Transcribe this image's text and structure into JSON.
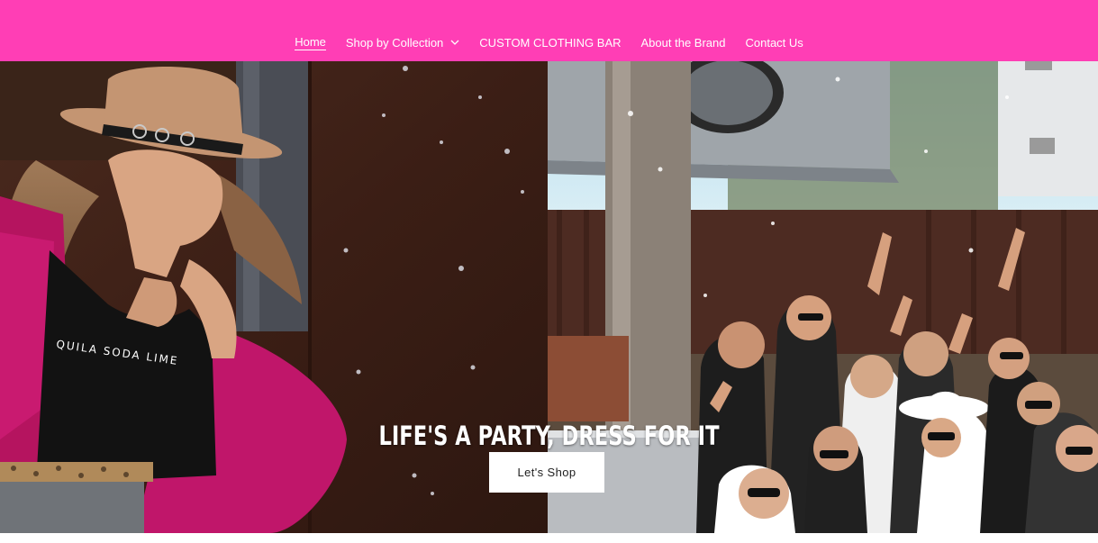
{
  "colors": {
    "header_bg": "#ff3eb5",
    "nav_text": "#ffffff",
    "button_bg": "#ffffff",
    "button_text": "#222222"
  },
  "nav": {
    "items": [
      {
        "label": "Home",
        "active": true
      },
      {
        "label": "Shop by Collection",
        "has_dropdown": true,
        "icon": "chevron-down-icon"
      },
      {
        "label": "CUSTOM CLOTHING BAR"
      },
      {
        "label": "About the Brand"
      },
      {
        "label": "Contact Us"
      }
    ]
  },
  "hero": {
    "headline": "LIFE'S A PARTY, DRESS FOR IT",
    "cta_label": "Let's Shop",
    "left_image_shirt_text": "QUILA SODA LIME"
  }
}
